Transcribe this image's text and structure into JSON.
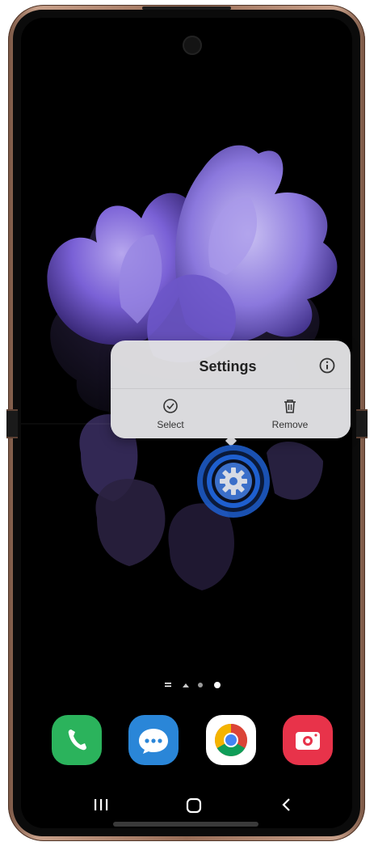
{
  "popup": {
    "title": "Settings",
    "actions": [
      {
        "label": "Select",
        "icon": "check-circle-icon"
      },
      {
        "label": "Remove",
        "icon": "trash-icon"
      }
    ],
    "info_icon": "info-icon"
  },
  "highlighted_app": {
    "icon": "gear-icon"
  },
  "page_indicator": {
    "pages": 4,
    "current": 4
  },
  "dock": [
    {
      "app": "Phone",
      "icon": "phone-icon"
    },
    {
      "app": "Messages",
      "icon": "messages-icon"
    },
    {
      "app": "Chrome",
      "icon": "chrome-icon"
    },
    {
      "app": "Camera",
      "icon": "camera-icon"
    }
  ],
  "nav": [
    {
      "action": "recents",
      "icon": "recents-icon"
    },
    {
      "action": "home",
      "icon": "home-icon"
    },
    {
      "action": "back",
      "icon": "back-icon"
    }
  ],
  "colors": {
    "frame": "#b08670",
    "popup": "#e2e2e4",
    "highlight": "#2a6ed8",
    "phone": "#2bb35c",
    "messages": "#2a86d8",
    "camera": "#e8334a"
  }
}
